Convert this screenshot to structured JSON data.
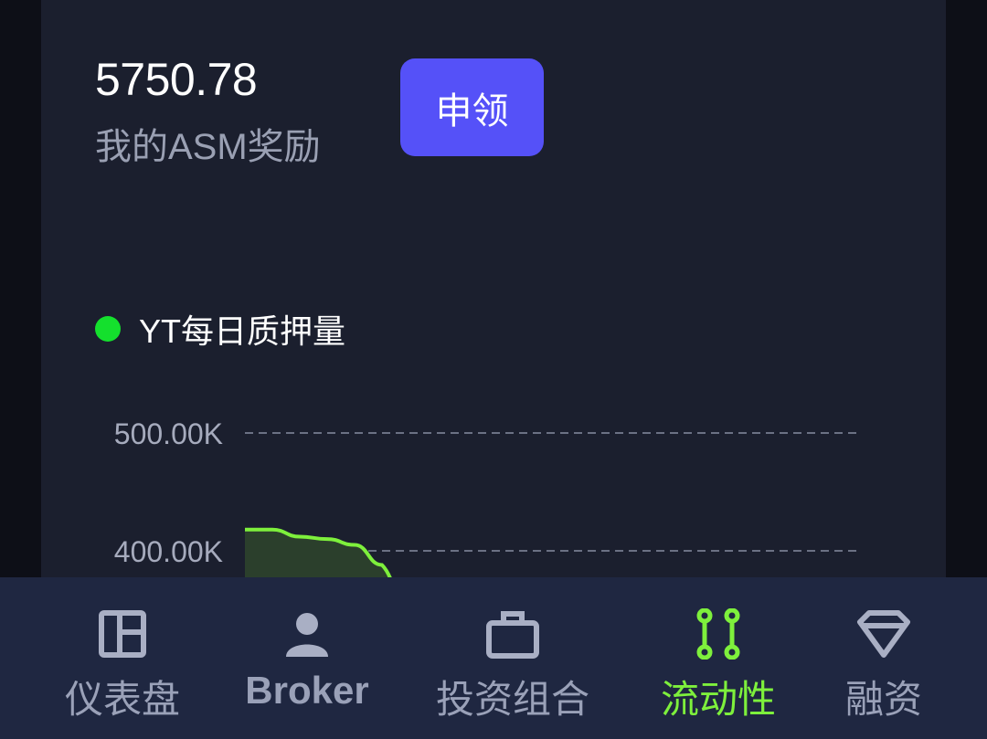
{
  "rewards": {
    "amount": "5750.78",
    "label": "我的ASM奖励",
    "claim_label": "申领"
  },
  "legend": {
    "label": "YT每日质押量",
    "color": "#14e02d"
  },
  "chart_data": {
    "type": "area",
    "title": "",
    "xlabel": "",
    "ylabel": "",
    "y_ticks": [
      "500.00K",
      "400.00K"
    ],
    "grid": true,
    "series": [
      {
        "name": "YT每日质押量",
        "color": "#7ef03c",
        "points": [
          {
            "x": 0,
            "y": 418000
          },
          {
            "x": 1,
            "y": 418000
          },
          {
            "x": 2,
            "y": 412000
          },
          {
            "x": 3,
            "y": 410000
          },
          {
            "x": 4,
            "y": 405000
          },
          {
            "x": 5,
            "y": 388000
          }
        ]
      }
    ]
  },
  "tabbar": {
    "active_color": "#7ef03c",
    "tabs": [
      {
        "label": "仪表盘",
        "icon": "dashboard-icon"
      },
      {
        "label": "Broker",
        "icon": "person-icon"
      },
      {
        "label": "投资组合",
        "icon": "briefcase-icon"
      },
      {
        "label": "流动性",
        "icon": "liquidity-icon",
        "active": true
      },
      {
        "label": "融资",
        "icon": "diamond-icon"
      }
    ]
  }
}
